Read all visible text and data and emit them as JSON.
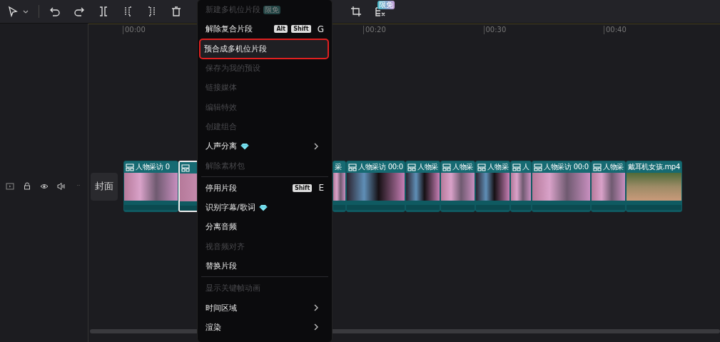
{
  "toolbar": {
    "badge": "限免"
  },
  "ruler": {
    "labels": [
      "00:00",
      "00:20",
      "00:30",
      "00:40"
    ]
  },
  "track": {
    "cover_label": "封面"
  },
  "clips": [
    {
      "label": "人物采访 0",
      "icon": true,
      "selected": false,
      "kind": "interview"
    },
    {
      "icon": true,
      "selected": true,
      "kind": "interview"
    },
    {
      "label": "采",
      "icon": false,
      "selected": false,
      "kind": "interview"
    },
    {
      "label": "人物采访 00:0",
      "icon": true,
      "selected": false,
      "kind": "studio"
    },
    {
      "label": "人物采",
      "icon": true,
      "selected": false,
      "kind": "studio"
    },
    {
      "label": "人物采",
      "icon": true,
      "selected": false,
      "kind": "interview"
    },
    {
      "label": "人物采",
      "icon": true,
      "selected": false,
      "kind": "studio"
    },
    {
      "label": "人",
      "icon": true,
      "selected": false,
      "kind": "interview"
    },
    {
      "label": "人物采访 00:0",
      "icon": true,
      "selected": false,
      "kind": "interview"
    },
    {
      "label": "人物采",
      "icon": true,
      "selected": false,
      "kind": "interview"
    },
    {
      "label": "戴耳机女孩.mp4",
      "icon": false,
      "selected": false,
      "kind": "outdoor"
    }
  ],
  "menu": [
    {
      "kind": "item",
      "label": "新建多机位片段",
      "disabled": true,
      "badge": "限免",
      "selected": false
    },
    {
      "kind": "item",
      "label": "解除复合片段",
      "disabled": false,
      "keys": [
        "Alt",
        "Shift"
      ],
      "key": "G",
      "selected": false
    },
    {
      "kind": "item",
      "label": "预合成多机位片段",
      "disabled": false,
      "selected": true,
      "outlined": true
    },
    {
      "kind": "item",
      "label": "保存为我的预设",
      "disabled": true,
      "selected": false
    },
    {
      "kind": "item",
      "label": "链接媒体",
      "disabled": true,
      "selected": false
    },
    {
      "kind": "item",
      "label": "编辑特效",
      "disabled": true,
      "selected": false
    },
    {
      "kind": "item",
      "label": "创建组合",
      "disabled": true,
      "selected": false
    },
    {
      "kind": "item",
      "label": "人声分离",
      "disabled": false,
      "premium": true,
      "submenu": true,
      "selected": false
    },
    {
      "kind": "item",
      "label": "解除素材包",
      "disabled": true,
      "selected": false
    },
    {
      "kind": "separator"
    },
    {
      "kind": "item",
      "label": "停用片段",
      "disabled": false,
      "keys": [
        "Shift"
      ],
      "key": "E",
      "selected": false
    },
    {
      "kind": "item",
      "label": "识别字幕/歌词",
      "disabled": false,
      "premium": true,
      "selected": false
    },
    {
      "kind": "item",
      "label": "分离音频",
      "disabled": false,
      "selected": false
    },
    {
      "kind": "item",
      "label": "视音频对齐",
      "disabled": true,
      "selected": false
    },
    {
      "kind": "item",
      "label": "替换片段",
      "disabled": false,
      "selected": false
    },
    {
      "kind": "separator"
    },
    {
      "kind": "item",
      "label": "显示关键帧动画",
      "disabled": true,
      "selected": false
    },
    {
      "kind": "item",
      "label": "时间区域",
      "disabled": false,
      "submenu": true,
      "selected": false
    },
    {
      "kind": "item",
      "label": "渲染",
      "disabled": false,
      "submenu": true,
      "selected": false
    }
  ]
}
